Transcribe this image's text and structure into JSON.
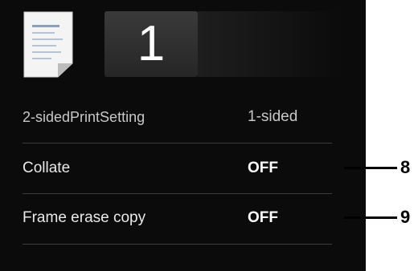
{
  "header": {
    "copies": "1",
    "document_icon": "document-icon"
  },
  "settings": [
    {
      "label": "2-sidedPrintSetting",
      "value": "1-sided"
    },
    {
      "label": "Collate",
      "value": "OFF"
    },
    {
      "label": "Frame erase copy",
      "value": "OFF"
    }
  ],
  "callouts": [
    {
      "number": "8"
    },
    {
      "number": "9"
    }
  ]
}
